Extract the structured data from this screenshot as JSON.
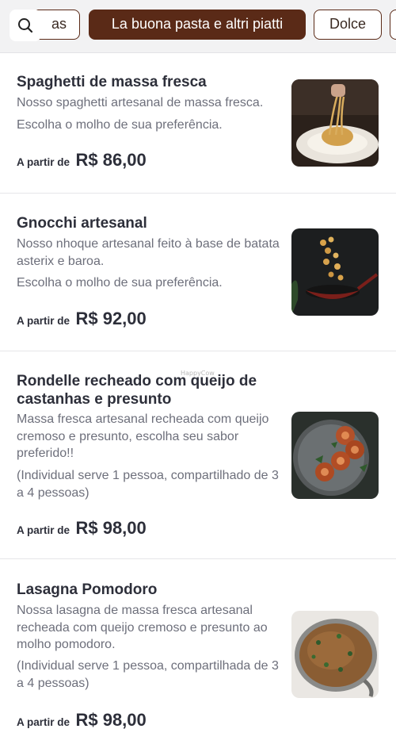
{
  "category_tabs": [
    {
      "label": "as",
      "active": false
    },
    {
      "label": "La buona pasta e altri piatti",
      "active": true
    },
    {
      "label": "Dolce",
      "active": false
    },
    {
      "label": "",
      "active": false
    }
  ],
  "colors": {
    "accent": "#5a2a17",
    "text": "#2d2f3a",
    "muted": "#6d6f7b",
    "divider": "#e6e6e9"
  },
  "icons": {
    "search": "search-icon"
  },
  "watermark": "HappyCow",
  "menu_items": [
    {
      "title": "Spaghetti de massa fresca",
      "description": [
        "Nosso spaghetti artesanal de massa fresca.",
        "Escolha o molho de sua preferência."
      ],
      "price_prefix": "A partir de",
      "price": "R$ 86,00",
      "image": "spaghetti-photo"
    },
    {
      "title": "Gnocchi artesanal",
      "description": [
        "Nosso nhoque artesanal feito à base de batata asterix e baroa.",
        "Escolha o molho de sua preferência."
      ],
      "price_prefix": "A partir de",
      "price": "R$ 92,00",
      "image": "gnocchi-photo"
    },
    {
      "title": "Rondelle recheado com queijo de castanhas e presunto",
      "description": [
        "Massa fresca artesanal recheada com queijo cremoso e presunto, escolha seu sabor preferido!!",
        "(Individual serve 1 pessoa, compartilhado de 3 a 4 pessoas)"
      ],
      "price_prefix": "A partir de",
      "price": "R$ 98,00",
      "image": "rondelle-photo"
    },
    {
      "title": "Lasagna Pomodoro",
      "description": [
        "Nossa lasagna de massa fresca artesanal recheada com queijo cremoso e presunto ao molho pomodoro.",
        "(Individual serve 1 pessoa, compartilhada de 3 a 4 pessoas)"
      ],
      "price_prefix": "A partir de",
      "price": "R$ 98,00",
      "image": "lasagna-photo"
    }
  ]
}
